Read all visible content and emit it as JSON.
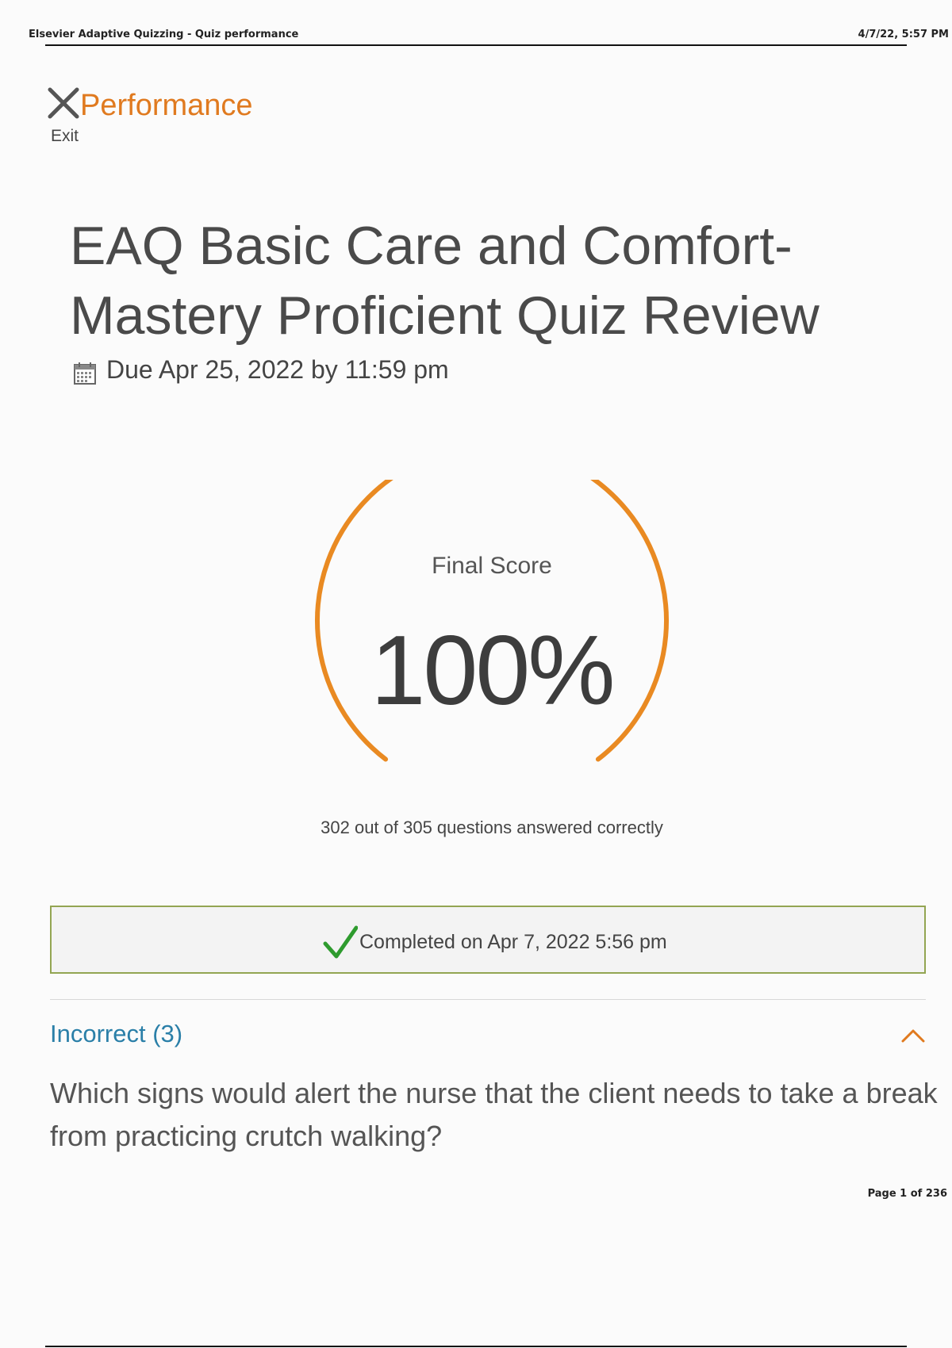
{
  "print_header": {
    "title": "Elsevier Adaptive Quizzing - Quiz performance",
    "datetime": "4/7/22, 5:57 PM"
  },
  "nav": {
    "exit_label": "Exit",
    "page_title": "Performance"
  },
  "quiz": {
    "title": "EAQ Basic Care and Comfort-Mastery Proficient Quiz Review",
    "due": "Due Apr 25, 2022 by 11:59 pm"
  },
  "score": {
    "label": "Final Score",
    "value": "100%",
    "fraction": 1.0,
    "summary": "302 out of 305 questions answered correctly"
  },
  "status": {
    "completed": "Completed on Apr 7, 2022 5:56 pm"
  },
  "incorrect_section": {
    "label": "Incorrect (3)",
    "question": "Which signs would alert the nurse that the client needs to take a break from practicing crutch walking?"
  },
  "page": {
    "label": "Page 1 of 236"
  },
  "colors": {
    "accent": "#e07a1f",
    "link": "#2a7fa8",
    "success": "#2e9b2e",
    "completed_border": "#93a552"
  },
  "icons": [
    "close-icon",
    "calendar-icon",
    "checkmark-icon",
    "chevron-up-icon"
  ]
}
